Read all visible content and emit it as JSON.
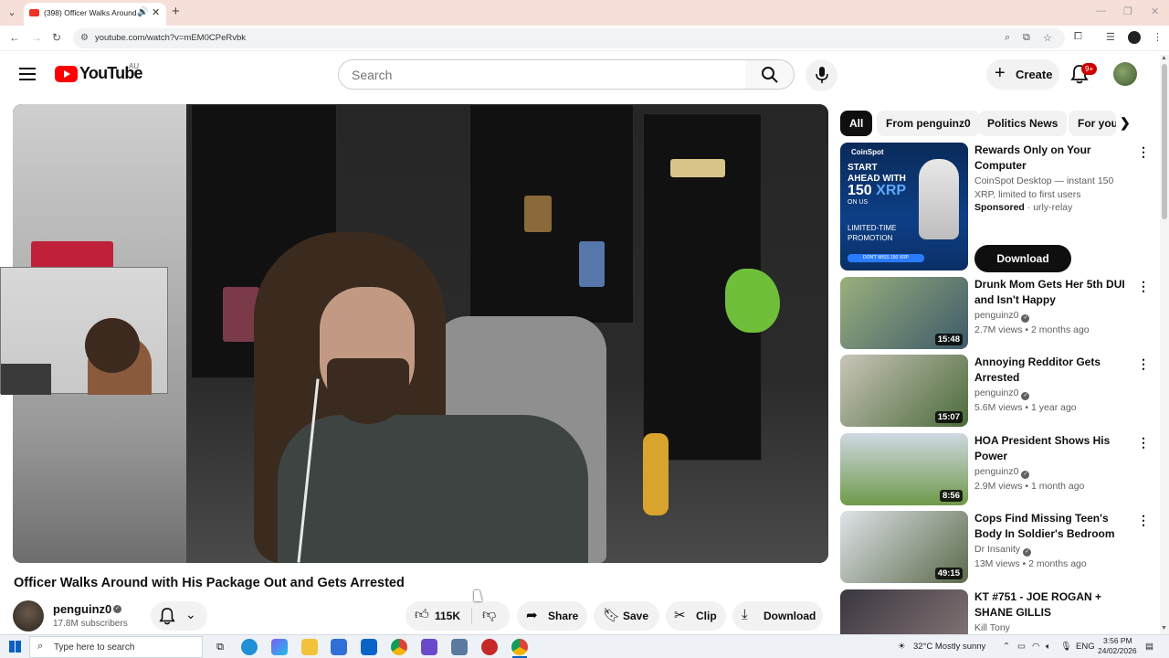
{
  "browser": {
    "tab_title": "(398) Officer Walks Around",
    "url": "youtube.com/watch?v=mEM0CPeRvbk"
  },
  "header": {
    "logo_text": "YouTube",
    "region": "AU",
    "search_placeholder": "Search",
    "create_label": "Create",
    "notification_count": "9+"
  },
  "video": {
    "title": "Officer Walks Around with His Package Out and Gets Arrested",
    "channel": "penguinz0",
    "subscribers": "17.8M subscribers",
    "likes": "115K",
    "actions": {
      "share": "Share",
      "save": "Save",
      "clip": "Clip",
      "download": "Download"
    }
  },
  "chips": [
    "All",
    "From penguinz0",
    "Politics News",
    "For you"
  ],
  "ad": {
    "title": "Rewards Only on Your Computer",
    "description": "CoinSpot Desktop — instant 150 XRP, limited to first users",
    "sponsored_label": "Sponsored",
    "advertiser": "urly-relay",
    "cta": "Download",
    "thumb": {
      "brand": "CoinSpot",
      "line1": "START AHEAD WITH",
      "amount_num": "150",
      "amount_unit": "XRP",
      "line2": "ON US",
      "line3": "LIMITED-TIME PROMOTION",
      "cta": "DON'T MISS 150 XRP"
    }
  },
  "recommendations": [
    {
      "title": "Drunk Mom Gets Her 5th DUI and Isn't Happy",
      "channel": "penguinz0",
      "verified": true,
      "meta": "2.7M views • 2 months ago",
      "duration": "15:48",
      "thumb_color": "#5b6b4a"
    },
    {
      "title": "Annoying Redditor Gets Arrested",
      "channel": "penguinz0",
      "verified": true,
      "meta": "5.6M views • 1 year ago",
      "duration": "15:07",
      "thumb_color": "#8a8f86"
    },
    {
      "title": "HOA President Shows His Power",
      "channel": "penguinz0",
      "verified": true,
      "meta": "2.9M views • 1 month ago",
      "duration": "8:56",
      "thumb_color": "#6f8a5a"
    },
    {
      "title": "Cops Find Missing Teen's Body In Soldier's Bedroom",
      "channel": "Dr Insanity",
      "verified": true,
      "meta": "13M views • 2 months ago",
      "duration": "49:15",
      "thumb_color": "#7a8290"
    },
    {
      "title": "KT #751 - JOE ROGAN + SHANE GILLIS",
      "channel": "Kill Tony",
      "verified": false,
      "meta": "",
      "duration": "",
      "thumb_color": "#4a4650"
    }
  ],
  "taskbar": {
    "search_text": "Type here to search",
    "weather": "32°C  Mostly sunny",
    "lang": "ENG",
    "time": "3:56 PM",
    "date": "24/02/2026"
  }
}
